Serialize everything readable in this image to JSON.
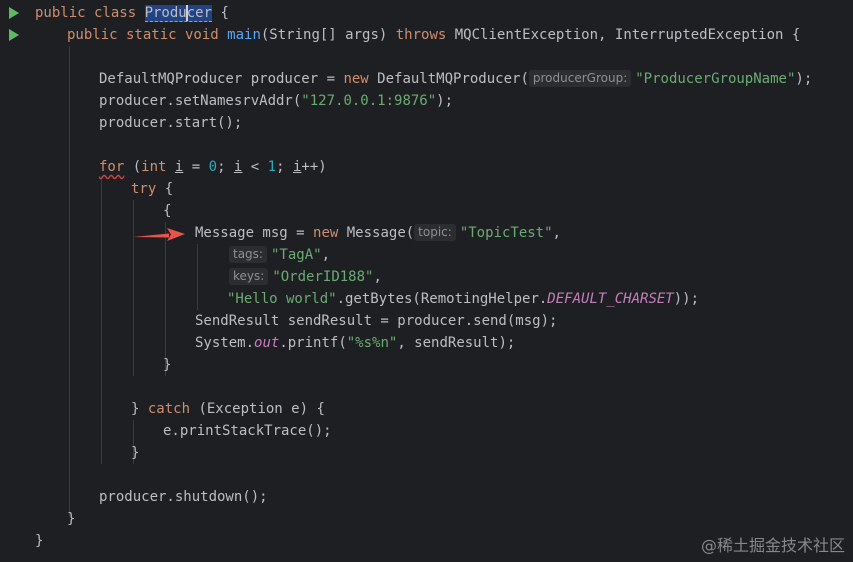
{
  "editor": {
    "accent_colors": {
      "keyword": "#cf8e6d",
      "function": "#56a8f5",
      "string": "#6aab73",
      "number": "#2aacb8",
      "constant": "#c77dbb",
      "run_icon": "#5fb865",
      "arrow": "#e8534a"
    },
    "gutter_icons": [
      "run-class-icon",
      "run-method-icon"
    ],
    "lines": {
      "l1_kw": "public class ",
      "l1_class_a": "Produ",
      "l1_class_b": "cer",
      "l1_brace": " {",
      "l2_kw1": "public static void ",
      "l2_fn": "main",
      "l2_params": "(String[] args) ",
      "l2_kw2": "throws",
      "l2_rest": " MQClientException, InterruptedException {",
      "l4_a": "DefaultMQProducer producer = ",
      "l4_new": "new",
      "l4_b": " DefaultMQProducer(",
      "l4_hint": "producerGroup:",
      "l4_str": "\"ProducerGroupName\"",
      "l4_end": ");",
      "l5_a": "producer.setNamesrvAddr(",
      "l5_str": "\"127.0.0.1:9876\"",
      "l5_end": ");",
      "l6": "producer.start();",
      "l8_for": "for",
      "l8_a": " (",
      "l8_int": "int",
      "l8_sp": " ",
      "l8_i1": "i",
      "l8_b": " = ",
      "l8_zero": "0",
      "l8_c": "; ",
      "l8_i2": "i",
      "l8_d": " < ",
      "l8_one": "1",
      "l8_e": "; ",
      "l8_i3": "i",
      "l8_f": "++)",
      "l9_try": "try",
      "l9_b": " {",
      "l10": "{",
      "l11_a": "Message msg = ",
      "l11_new": "new",
      "l11_b": " Message(",
      "l11_hint": "topic:",
      "l11_str": "\"TopicTest\"",
      "l11_end": ",",
      "l12_hint": "tags:",
      "l12_str": "\"TagA\"",
      "l12_end": ",",
      "l13_hint": "keys:",
      "l13_str": "\"OrderID188\"",
      "l13_end": ",",
      "l14_str": "\"Hello world\"",
      "l14_a": ".getBytes(RemotingHelper.",
      "l14_const": "DEFAULT_CHARSET",
      "l14_end": "));",
      "l15": "SendResult sendResult = producer.send(msg);",
      "l16_a": "System.",
      "l16_out": "out",
      "l16_b": ".printf(",
      "l16_str": "\"%s%n\"",
      "l16_end": ", sendResult);",
      "l17": "}",
      "l19_a": "} ",
      "l19_catch": "catch",
      "l19_b": " (Exception e) {",
      "l20": "e.printStackTrace();",
      "l21": "}",
      "l23": "producer.shutdown();",
      "l24": "}",
      "l25": "}"
    }
  },
  "watermark": "@稀土掘金技术社区"
}
